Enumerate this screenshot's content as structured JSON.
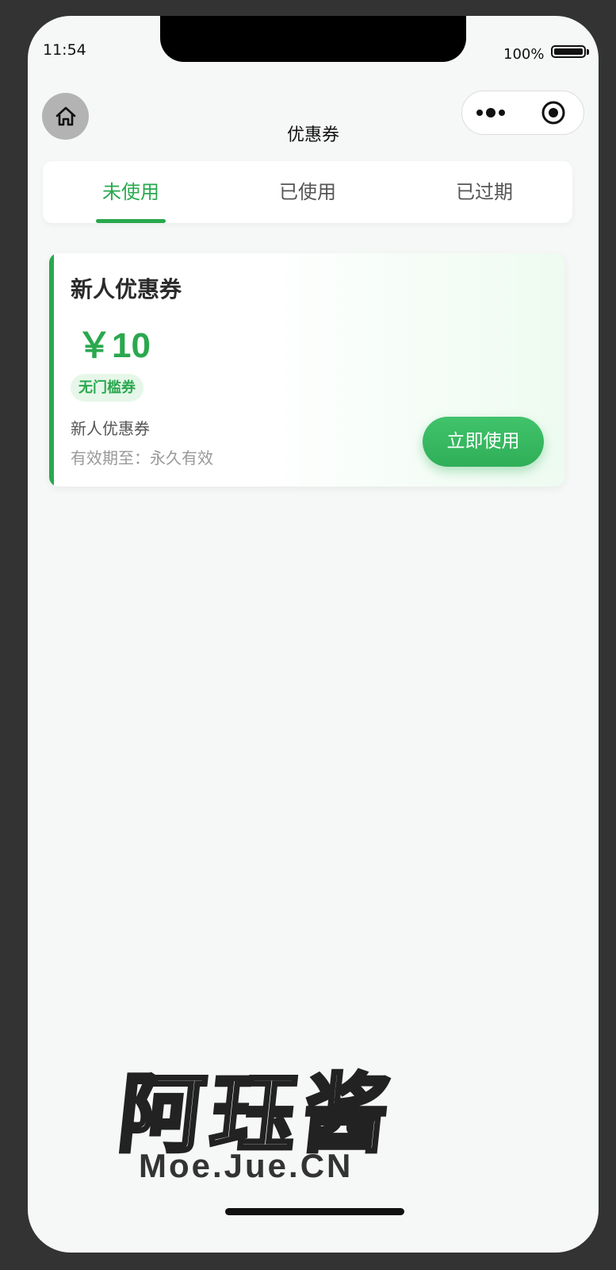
{
  "status_bar": {
    "time": "11:54",
    "battery": "100%"
  },
  "nav": {
    "title": "优惠券"
  },
  "tabs": [
    {
      "label": "未使用",
      "active": true
    },
    {
      "label": "已使用",
      "active": false
    },
    {
      "label": "已过期",
      "active": false
    }
  ],
  "coupon": {
    "title": "新人优惠券",
    "amount": "￥10",
    "tag": "无门槛券",
    "description": "新人优惠券",
    "expiry": "有效期至：永久有效",
    "button_label": "立即使用"
  },
  "watermark": {
    "main": "阿珏酱",
    "sub": "Moe.Jue.CN"
  },
  "colors": {
    "accent": "#2aa84e",
    "background": "#f6f8f7"
  },
  "icons": [
    "home-icon",
    "more-icon",
    "close-circle-icon",
    "battery-icon"
  ]
}
